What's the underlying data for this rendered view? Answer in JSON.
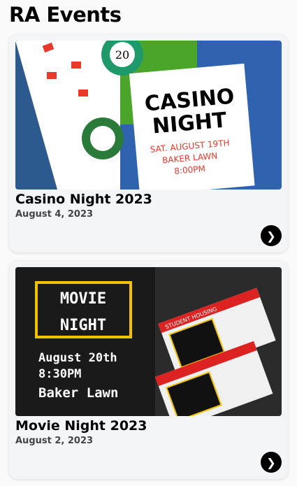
{
  "page_title": "RA Events",
  "events": [
    {
      "title": "Casino Night 2023",
      "date": "August 4, 2023",
      "poster": {
        "line1": "CASINO",
        "line2": "NIGHT",
        "details": [
          "SAT. AUGUST 19TH",
          "BAKER LAWN",
          "8:00PM"
        ],
        "chip": "20"
      }
    },
    {
      "title": "Movie Night 2023",
      "date": "August 2, 2023",
      "poster": {
        "line1": "MOVIE",
        "line2": "NIGHT",
        "details": [
          "August 20th",
          "8:30PM",
          "Baker Lawn"
        ],
        "ticket": "STUDENT HOUSING"
      }
    }
  ]
}
